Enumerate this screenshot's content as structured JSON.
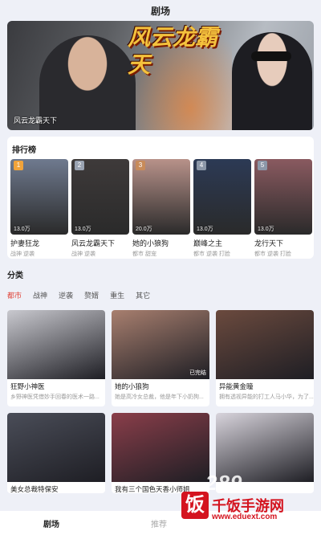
{
  "header": {
    "title": "剧场"
  },
  "hero": {
    "title_art": "风云龙霸天",
    "caption": "风云龙霸天下"
  },
  "ranking": {
    "title": "排行榜",
    "items": [
      {
        "rank": "1",
        "name": "护妻狂龙",
        "tags": "战神  逆袭",
        "views": "13.0万",
        "badge_color": "#f1a33a",
        "bg": "#6f7a8f"
      },
      {
        "rank": "2",
        "name": "风云龙霸天下",
        "tags": "战神  逆袭",
        "views": "13.0万",
        "badge_color": "#9aa3b2",
        "bg": "#3e3a3a"
      },
      {
        "rank": "3",
        "name": "她的小狼狗",
        "tags": "都市  甜宠",
        "views": "20.0万",
        "badge_color": "#c88b5a",
        "bg": "#b8928a"
      },
      {
        "rank": "4",
        "name": "巅峰之主",
        "tags": "都市  逆袭  打脸",
        "views": "13.0万",
        "badge_color": "#8c97a8",
        "bg": "#2c3a55"
      },
      {
        "rank": "5",
        "name": "龙行天下",
        "tags": "都市  逆袭  打脸",
        "views": "13.0万",
        "badge_color": "#8c97a8",
        "bg": "#8a5a60"
      }
    ]
  },
  "category": {
    "title": "分类",
    "tabs": [
      "都市",
      "战神",
      "逆袭",
      "赘婿",
      "重生",
      "其它"
    ],
    "active": "都市"
  },
  "cards": [
    {
      "title": "狂野小神医",
      "desc": "乡野神医凭借妙手回春的医术一路...",
      "ep": "",
      "bg": "#c9c9cf"
    },
    {
      "title": "她的小狼狗",
      "desc": "她是高冷女总裁，他是年下小奶狗...",
      "ep": "已完结",
      "bg": "#a87f6f"
    },
    {
      "title": "异能黄金瞳",
      "desc": "拥有透视异能的打工人马小华，为了...",
      "ep": "",
      "bg": "#6b4a3e"
    },
    {
      "title": "美女总裁特保安",
      "desc": "",
      "ep": "",
      "bg": "#4a4d58"
    },
    {
      "title": "我有三个国色天香小师姐",
      "desc": "",
      "ep": "",
      "bg": "#8a3e4a"
    },
    {
      "title": "",
      "desc": "",
      "ep": "",
      "bg": "#d8d4dc"
    }
  ],
  "tabbar": {
    "theater": "剧场",
    "recommend": "推荐"
  },
  "watermark": {
    "num": "289",
    "logo_char": "饭",
    "brand": "千饭手游网",
    "url": "www.eduext.com"
  }
}
